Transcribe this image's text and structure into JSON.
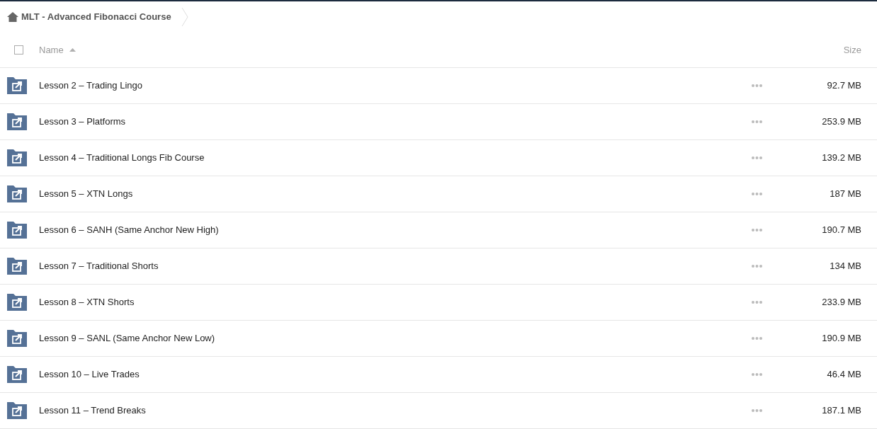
{
  "breadcrumb": {
    "title": "MLT - Advanced Fibonacci Course"
  },
  "table": {
    "select_all": {
      "checked": false
    },
    "columns": [
      {
        "label": "Name",
        "sorted": true
      },
      {
        "label": "Size",
        "sorted": false
      }
    ],
    "rows": [
      {
        "name": "Lesson 2 – Trading Lingo",
        "size": "92.7 MB"
      },
      {
        "name": "Lesson 3 – Platforms",
        "size": "253.9 MB"
      },
      {
        "name": "Lesson 4 – Traditional Longs Fib Course",
        "size": "139.2 MB"
      },
      {
        "name": "Lesson 5 – XTN Longs",
        "size": "187 MB"
      },
      {
        "name": "Lesson 6 – SANH (Same Anchor New High)",
        "size": "190.7 MB"
      },
      {
        "name": "Lesson 7 – Traditional Shorts",
        "size": "134 MB"
      },
      {
        "name": "Lesson 8 – XTN Shorts",
        "size": "233.9 MB"
      },
      {
        "name": "Lesson 9 – SANL (Same Anchor New Low)",
        "size": "190.9 MB"
      },
      {
        "name": "Lesson 10 – Live Trades",
        "size": "46.4 MB"
      },
      {
        "name": "Lesson 11 – Trend Breaks",
        "size": "187.1 MB"
      }
    ]
  }
}
